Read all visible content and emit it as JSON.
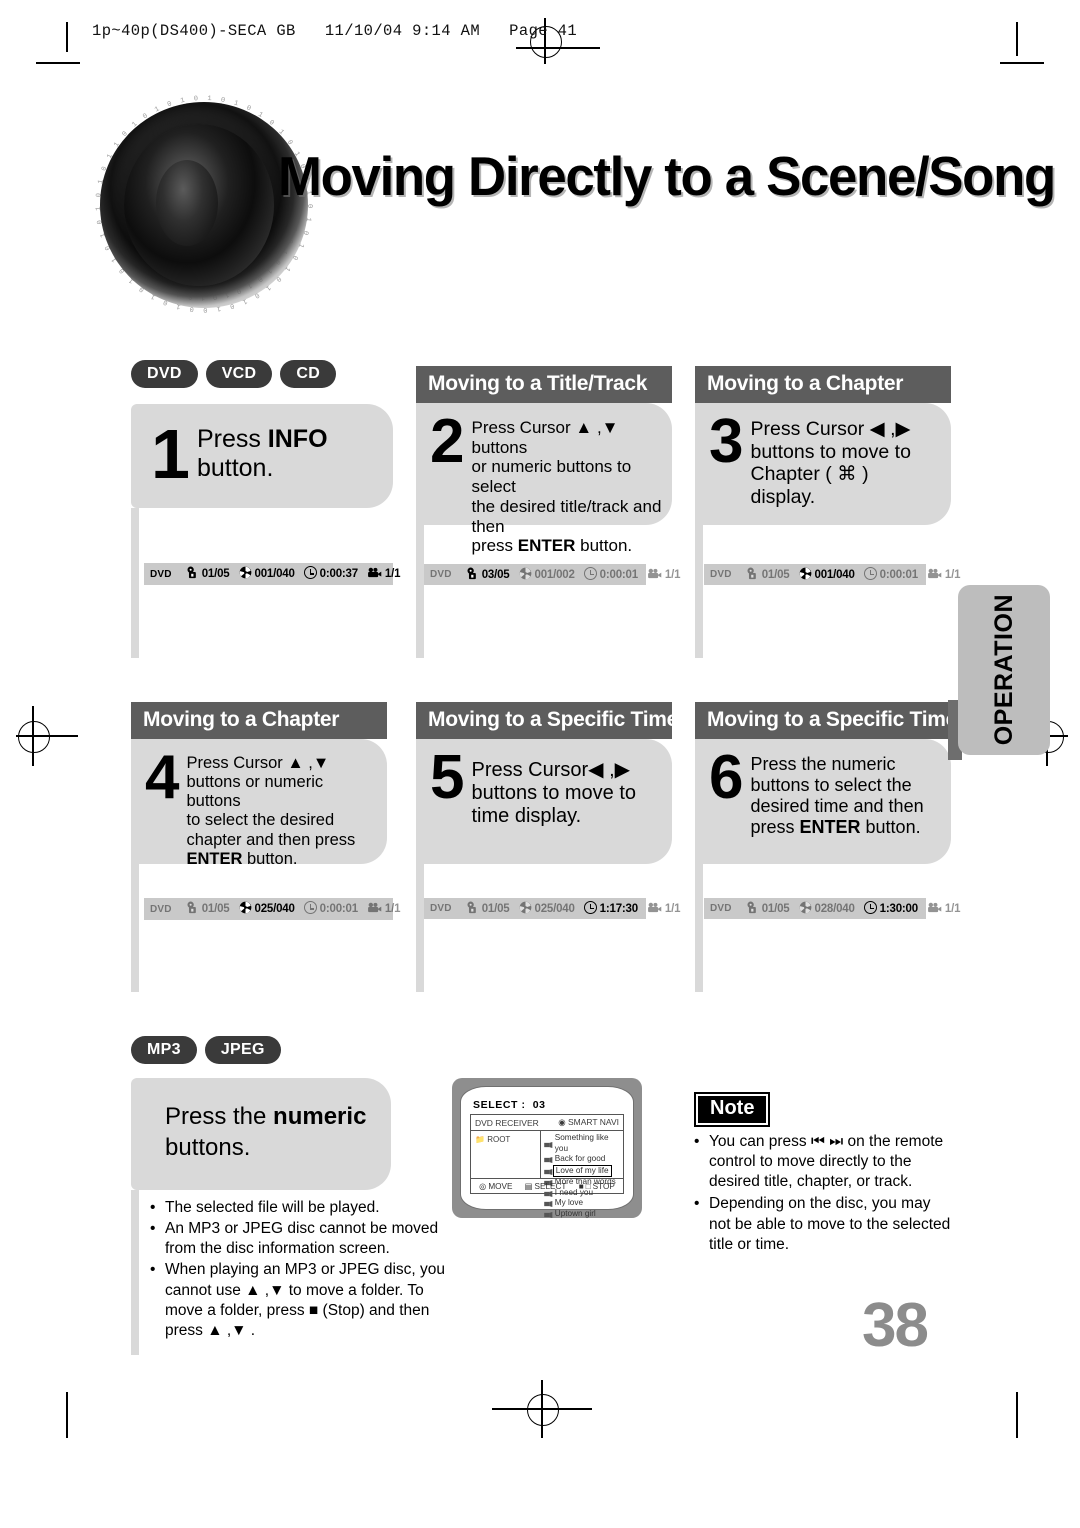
{
  "print_header": "1p~40p(DS400)-SECA GB   11/10/04 9:14 AM   Page 41",
  "title": "Moving Directly to a Scene/Song",
  "side_tab": "OPERATION",
  "page_number": "38",
  "media_badges_top": [
    "DVD",
    "VCD",
    "CD"
  ],
  "media_badges_bottom": [
    "MP3",
    "JPEG"
  ],
  "steps": [
    {
      "num": "1",
      "header": "",
      "text_html": "Press <b>INFO</b> button."
    },
    {
      "num": "2",
      "header": "Moving to a Title/Track",
      "text_html": "Press Cursor ▲ ,▼  buttons<br>or numeric buttons to select<br>the desired title/track and then<br>press <b>ENTER</b> button."
    },
    {
      "num": "3",
      "header": "Moving to a Chapter",
      "text_html": "Press Cursor ◀ ,▶<br>buttons to move to<br>Chapter ( ⌘ )<br>display."
    },
    {
      "num": "4",
      "header": "Moving to a Chapter",
      "text_html": "Press Cursor ▲ ,▼<br>buttons or numeric buttons<br>to select the desired<br>chapter and then press<br><b>ENTER</b> button."
    },
    {
      "num": "5",
      "header": "Moving to a Specific Time",
      "text_html": "Press Cursor◀ ,▶<br>buttons to move to<br>time display."
    },
    {
      "num": "6",
      "header": "Moving to a Specific Time",
      "text_html": "Press the numeric<br>buttons to select the<br>desired time and then<br>press <b>ENTER</b> button."
    }
  ],
  "osd_bars": [
    {
      "disc_label": "DVD",
      "segments": [
        {
          "icon": "title-icon",
          "value": "01/05",
          "active": true
        },
        {
          "icon": "chapter-icon",
          "value": "001/040",
          "active": true
        },
        {
          "icon": "clock-icon",
          "value": "0:00:37",
          "active": true
        },
        {
          "icon": "angle-icon",
          "value": "1/1",
          "active": true
        }
      ],
      "disc_active": true
    },
    {
      "disc_label": "DVD",
      "segments": [
        {
          "icon": "title-icon",
          "value": "03/05",
          "active": true
        },
        {
          "icon": "chapter-icon",
          "value": "001/002",
          "active": false
        },
        {
          "icon": "clock-icon",
          "value": "0:00:01",
          "active": false
        },
        {
          "icon": "angle-icon",
          "value": "1/1",
          "active": false
        }
      ],
      "disc_active": false
    },
    {
      "disc_label": "DVD",
      "segments": [
        {
          "icon": "title-icon",
          "value": "01/05",
          "active": false
        },
        {
          "icon": "chapter-icon",
          "value": "001/040",
          "active": true
        },
        {
          "icon": "clock-icon",
          "value": "0:00:01",
          "active": false
        },
        {
          "icon": "angle-icon",
          "value": "1/1",
          "active": false
        }
      ],
      "disc_active": false
    },
    {
      "disc_label": "DVD",
      "segments": [
        {
          "icon": "title-icon",
          "value": "01/05",
          "active": false
        },
        {
          "icon": "chapter-icon",
          "value": "025/040",
          "active": true
        },
        {
          "icon": "clock-icon",
          "value": "0:00:01",
          "active": false
        },
        {
          "icon": "angle-icon",
          "value": "1/1",
          "active": false
        }
      ],
      "disc_active": false
    },
    {
      "disc_label": "DVD",
      "segments": [
        {
          "icon": "title-icon",
          "value": "01/05",
          "active": false
        },
        {
          "icon": "chapter-icon",
          "value": "025/040",
          "active": false
        },
        {
          "icon": "clock-icon",
          "value": "1:17:30",
          "active": true
        },
        {
          "icon": "angle-icon",
          "value": "1/1",
          "active": false
        }
      ],
      "disc_active": false
    },
    {
      "disc_label": "DVD",
      "segments": [
        {
          "icon": "title-icon",
          "value": "01/05",
          "active": false
        },
        {
          "icon": "chapter-icon",
          "value": "028/040",
          "active": false
        },
        {
          "icon": "clock-icon",
          "value": "1:30:00",
          "active": true
        },
        {
          "icon": "angle-icon",
          "value": "1/1",
          "active": false
        }
      ],
      "disc_active": false
    }
  ],
  "mp3_step": {
    "text_html": "Press the <b>numeric</b><br>buttons."
  },
  "mp3_bullets": [
    "The selected file will be played.",
    "An MP3 or JPEG disc cannot be moved from the disc information screen.",
    "When playing an MP3 or JPEG disc, you cannot use ▲ ,▼  to move a folder. To move a folder, press ■ (Stop) and then press ▲ ,▼ ."
  ],
  "note": {
    "label": "Note",
    "bullets": [
      "You can press ⏮ ⏭  on the remote control to move directly to the desired title, chapter, or track.",
      "Depending on the disc, you may not be able to move to the selected title or time."
    ]
  },
  "tv_screen": {
    "select_label": "SELECT :",
    "select_value": "03",
    "receiver_label": "DVD RECEIVER",
    "smart_navi_label": "SMART NAVI",
    "root_label": "ROOT",
    "songs": [
      "Something like you",
      "Back for good",
      "Love of my life",
      "More than words",
      "I need you",
      "My love",
      "Uptown girl"
    ],
    "selected_song_index": 2,
    "footer": [
      "MOVE",
      "SELECT",
      "STOP"
    ]
  }
}
